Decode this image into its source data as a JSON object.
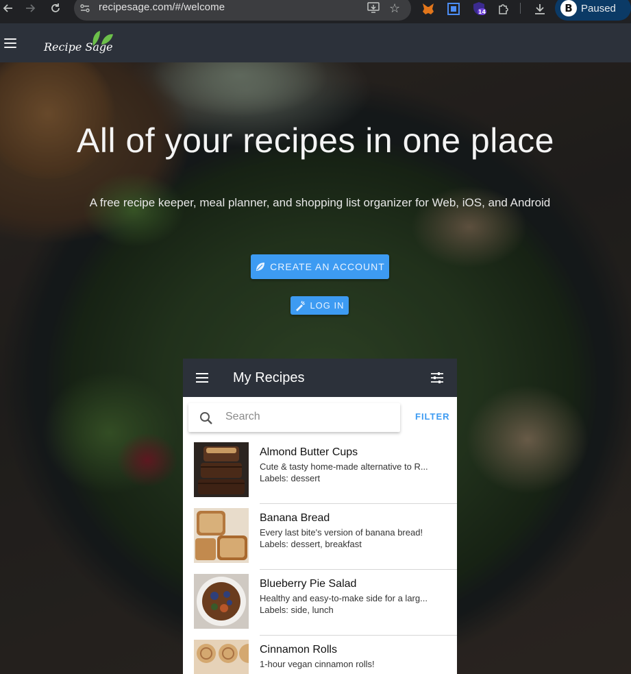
{
  "browser": {
    "url": "recipesage.com/#/welcome",
    "extension_badge": "14",
    "profile_initial": "B",
    "profile_status": "Paused"
  },
  "app": {
    "logo_text": "Recipe Sage"
  },
  "hero": {
    "title": "All of your recipes in one place",
    "subtitle": "A free recipe keeper, meal planner, and shopping list organizer for Web, iOS, and Android",
    "create_account_label": "CREATE AN ACCOUNT",
    "login_label": "LOG IN"
  },
  "preview": {
    "title": "My Recipes",
    "search_placeholder": "Search",
    "filter_label": "FILTER",
    "recipes": [
      {
        "title": "Almond Butter Cups",
        "description": "Cute & tasty home-made alternative to R...",
        "labels": "Labels: dessert"
      },
      {
        "title": "Banana Bread",
        "description": "Every last bite's version of banana bread!",
        "labels": "Labels: dessert, breakfast"
      },
      {
        "title": "Blueberry Pie Salad",
        "description": "Healthy and easy-to-make side for a larg...",
        "labels": "Labels: side, lunch"
      },
      {
        "title": "Cinnamon Rolls",
        "description": "1-hour vegan cinnamon rolls!",
        "labels": ""
      }
    ]
  },
  "colors": {
    "accent": "#3d9bf2",
    "toolbar": "#2c313a"
  }
}
